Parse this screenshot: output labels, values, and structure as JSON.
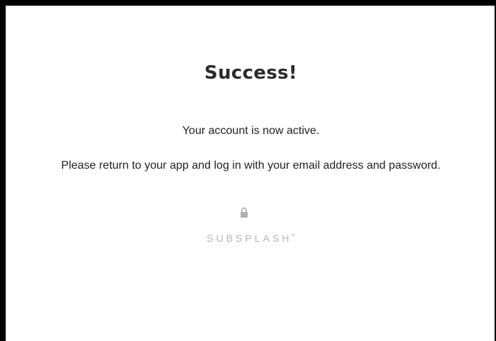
{
  "heading": "Success!",
  "message": {
    "line1": "Your account is now active.",
    "line2": "Please return to your app and log in with your email address and password."
  },
  "footer": {
    "lock_icon": "lock-icon",
    "brand": "SUBSPLASH",
    "brand_mark": "®"
  }
}
